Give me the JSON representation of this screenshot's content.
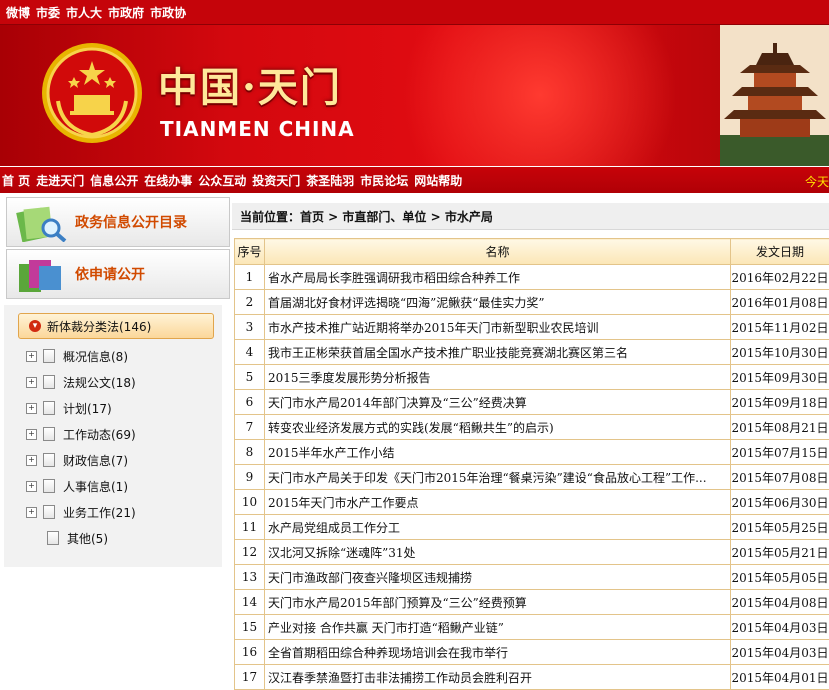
{
  "topbar": {
    "links": [
      "微博",
      "市委",
      "市人大",
      "市政府",
      "市政协"
    ]
  },
  "banner": {
    "title_cn": "中国·天门",
    "title_en": "TIANMEN CHINA"
  },
  "nav": {
    "items": [
      "首 页",
      "走进天门",
      "信息公开",
      "在线办事",
      "公众互动",
      "投资天门",
      "茶圣陆羽",
      "市民论坛",
      "网站帮助"
    ],
    "today": "今天"
  },
  "sidebar": {
    "btn1": "政务信息公开目录",
    "btn2": "依申请公开",
    "root": "新体裁分类法(146)",
    "nodes": [
      "概况信息(8)",
      "法规公文(18)",
      "计划(17)",
      "工作动态(69)",
      "财政信息(7)",
      "人事信息(1)",
      "业务工作(21)",
      "其他(5)"
    ]
  },
  "breadcrumb": "当前位置：首页 > 市直部门、单位 > 市水产局",
  "table": {
    "headers": [
      "序号",
      "名称",
      "发文日期"
    ],
    "rows": [
      [
        "1",
        "省水产局局长李胜强调研我市稻田综合种养工作",
        "2016年02月22日"
      ],
      [
        "2",
        "首届湖北好食材评选揭晓“四海”泥鳅获“最佳实力奖”",
        "2016年01月08日"
      ],
      [
        "3",
        "市水产技术推广站近期将举办2015年天门市新型职业农民培训",
        "2015年11月02日"
      ],
      [
        "4",
        "我市王正彬荣获首届全国水产技术推广职业技能竞赛湖北赛区第三名",
        "2015年10月30日"
      ],
      [
        "5",
        "2015三季度发展形势分析报告",
        "2015年09月30日"
      ],
      [
        "6",
        "天门市水产局2014年部门决算及“三公”经费决算",
        "2015年09月18日"
      ],
      [
        "7",
        "转变农业经济发展方式的实践(发展“稻鳅共生”的启示)",
        "2015年08月21日"
      ],
      [
        "8",
        "2015半年水产工作小结",
        "2015年07月15日"
      ],
      [
        "9",
        "天门市水产局关于印发《天门市2015年治理“餐桌污染”建设“食品放心工程”工作...",
        "2015年07月08日"
      ],
      [
        "10",
        "2015年天门市水产工作要点",
        "2015年06月30日"
      ],
      [
        "11",
        "水产局党组成员工作分工",
        "2015年05月25日"
      ],
      [
        "12",
        "汉北河又拆除“迷魂阵”31处",
        "2015年05月21日"
      ],
      [
        "13",
        "天门市渔政部门夜查兴隆坝区违规捕捞",
        "2015年05月05日"
      ],
      [
        "14",
        "天门市水产局2015年部门预算及“三公”经费预算",
        "2015年04月08日"
      ],
      [
        "15",
        "产业对接 合作共赢 天门市打造“稻鳅产业链”",
        "2015年04月03日"
      ],
      [
        "16",
        "全省首期稻田综合种养现场培训会在我市举行",
        "2015年04月03日"
      ],
      [
        "17",
        "汉江春季禁渔暨打击非法捕捞工作动员会胜利召开",
        "2015年04月01日"
      ]
    ]
  }
}
